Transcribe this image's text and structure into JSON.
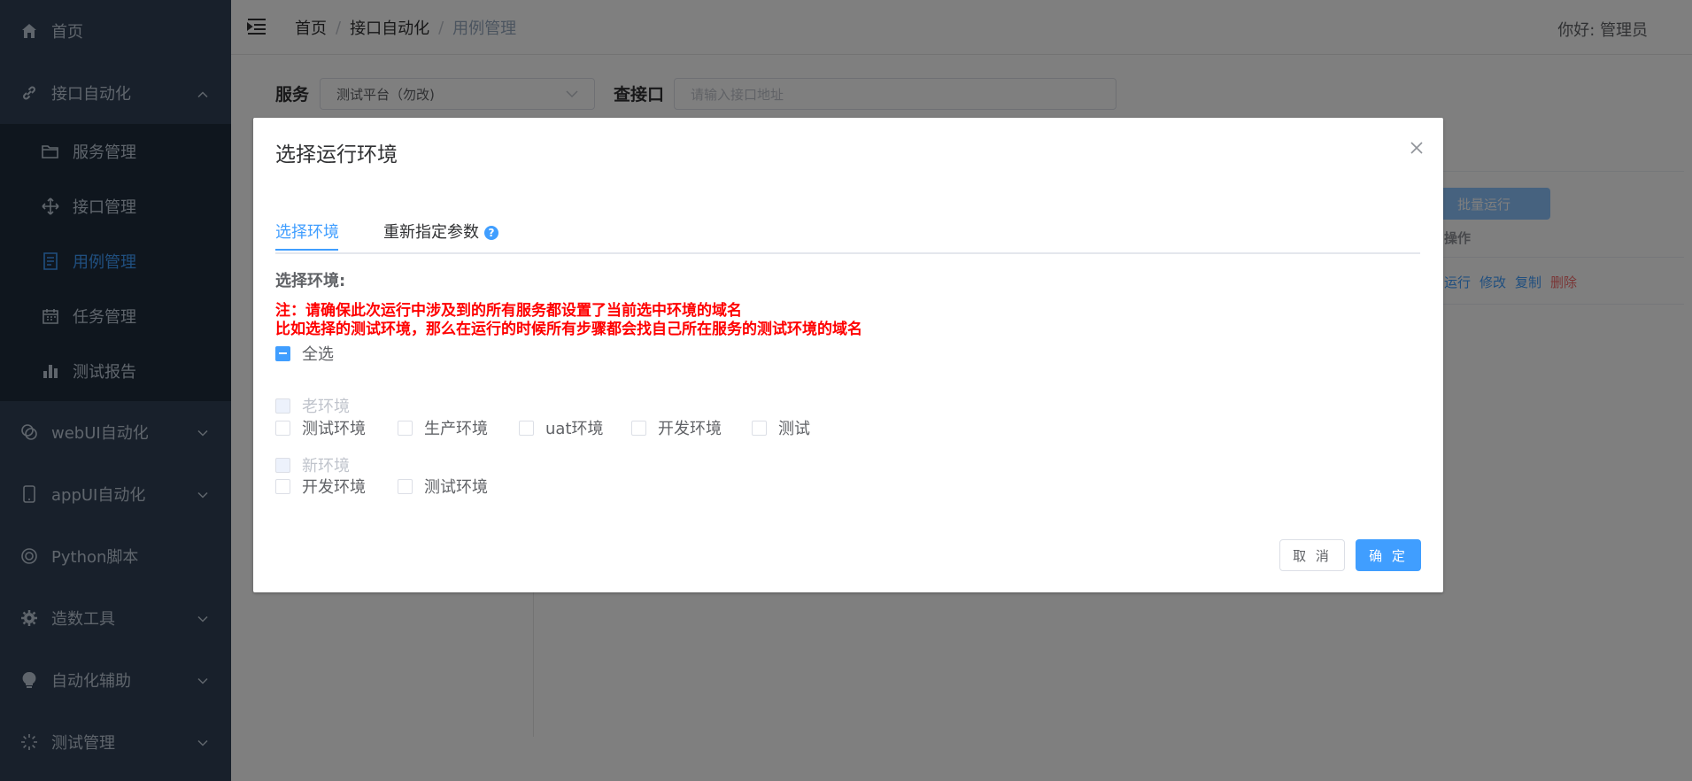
{
  "sidebar": {
    "items": [
      {
        "label": "首页",
        "icon": "home-icon"
      },
      {
        "label": "接口自动化",
        "icon": "link-icon",
        "expanded": true
      },
      {
        "label": "webUI自动化",
        "icon": "layers-icon"
      },
      {
        "label": "appUI自动化",
        "icon": "mobile-icon"
      },
      {
        "label": "Python脚本",
        "icon": "lifebuoy-icon"
      },
      {
        "label": "造数工具",
        "icon": "gear-icon"
      },
      {
        "label": "自动化辅助",
        "icon": "bulb-icon"
      },
      {
        "label": "测试管理",
        "icon": "loading-icon"
      }
    ],
    "subitems": [
      {
        "label": "服务管理",
        "icon": "folder-icon"
      },
      {
        "label": "接口管理",
        "icon": "move-icon"
      },
      {
        "label": "用例管理",
        "icon": "document-icon",
        "active": true
      },
      {
        "label": "任务管理",
        "icon": "calendar-icon"
      },
      {
        "label": "测试报告",
        "icon": "bar-chart-icon"
      }
    ]
  },
  "header": {
    "breadcrumb": [
      "首页",
      "接口自动化",
      "用例管理"
    ],
    "greeting": "你好:  管理员"
  },
  "filters": {
    "service_label": "服务",
    "service_value": "测试平台（勿改)",
    "api_label": "查接口",
    "api_placeholder": "请输入接口地址"
  },
  "table": {
    "batch_button": "批量运行",
    "op_header": "操作",
    "row_actions": [
      "运行",
      "修改",
      "复制",
      "删除"
    ]
  },
  "dialog": {
    "title": "选择运行环境",
    "tabs": [
      "选择环境",
      "重新指定参数"
    ],
    "section_label": "选择环境:",
    "warning_line1": "注：请确保此次运行中涉及到的所有服务都设置了当前选中环境的域名",
    "warning_line2": "比如选择的测试环境，那么在运行的时候所有步骤都会找自己所在服务的测试环境的域名",
    "select_all": "全选",
    "groups": [
      {
        "name": "老环境",
        "options": [
          "测试环境",
          "生产环境",
          "uat环境",
          "开发环境",
          "测试"
        ]
      },
      {
        "name": "新环境",
        "options": [
          "开发环境",
          "测试环境"
        ]
      }
    ],
    "cancel": "取 消",
    "confirm": "确 定"
  },
  "colors": {
    "sidebar_bg": "#304156",
    "submenu_bg": "#1f2d3d",
    "accent": "#409eff",
    "warning": "#ff0000"
  }
}
